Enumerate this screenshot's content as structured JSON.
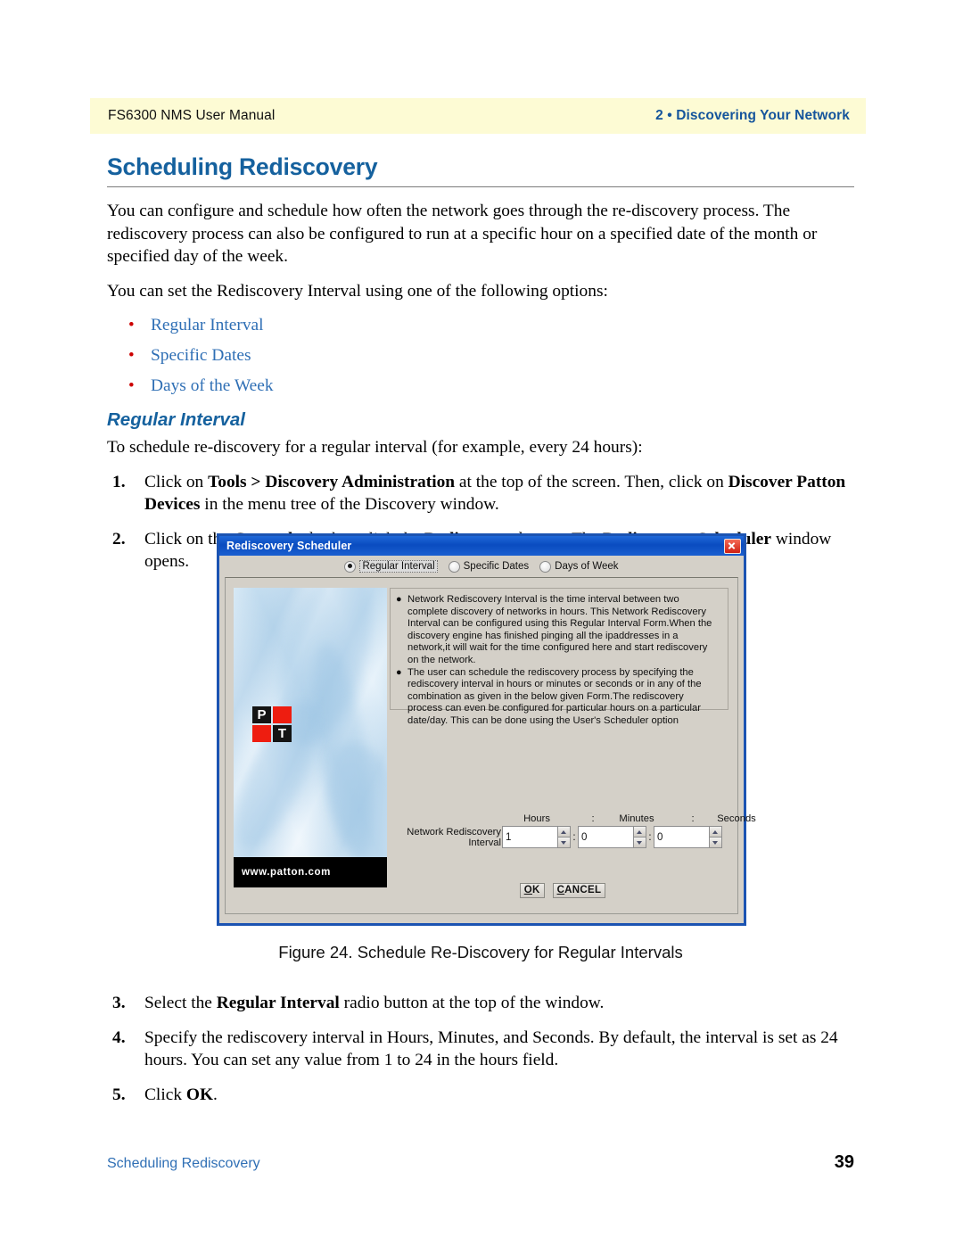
{
  "header": {
    "left": "FS6300 NMS User Manual",
    "right": "2 • Discovering Your Network"
  },
  "section": {
    "title": "Scheduling Rediscovery",
    "para1": "You can configure and schedule how often the network goes through the re-discovery process. The rediscovery process can also be configured to run at a specific hour on a specified date of the month or specified day of the week.",
    "para2": "You can set the Rediscovery Interval using one of the following options:",
    "options": [
      "Regular Interval",
      "Specific Dates",
      "Days of the Week"
    ],
    "subtitle": "Regular Interval",
    "para3": "To schedule re-discovery for a regular interval (for example, every 24 hours):"
  },
  "steps": [
    {
      "num": "1.",
      "parts": [
        {
          "t": "Click on ",
          "b": false
        },
        {
          "t": "Tools > Discovery Administration",
          "b": true
        },
        {
          "t": " at the top of the screen. Then, click on ",
          "b": false
        },
        {
          "t": "Discover Patton Devices",
          "b": true
        },
        {
          "t": " in the menu tree of the Discovery window.",
          "b": false
        }
      ]
    },
    {
      "num": "2.",
      "parts": [
        {
          "t": "Click on the ",
          "b": false
        },
        {
          "t": "General",
          "b": true
        },
        {
          "t": " tab, then click the ",
          "b": false
        },
        {
          "t": "Rediscovery",
          "b": true
        },
        {
          "t": " button. The ",
          "b": false
        },
        {
          "t": "Rediscovery Scheduler",
          "b": true
        },
        {
          "t": " window opens.",
          "b": false
        }
      ]
    },
    {
      "num": "3.",
      "parts": [
        {
          "t": "Select the ",
          "b": false
        },
        {
          "t": "Regular Interval",
          "b": true
        },
        {
          "t": " radio button at the top of the window.",
          "b": false
        }
      ]
    },
    {
      "num": "4.",
      "parts": [
        {
          "t": "Specify the rediscovery interval in Hours, Minutes, and Seconds. By default, the interval is set as 24 hours. You can set any value from 1 to 24 in the hours field.",
          "b": false
        }
      ]
    },
    {
      "num": "5.",
      "parts": [
        {
          "t": "Click ",
          "b": false
        },
        {
          "t": "OK",
          "b": true
        },
        {
          "t": ".",
          "b": false
        }
      ]
    }
  ],
  "figure": {
    "caption": "Figure 24. Schedule Re-Discovery for Regular Intervals"
  },
  "dialog": {
    "title": "Rediscovery Scheduler",
    "close_label": "×",
    "radios": [
      {
        "label": "Regular Interval",
        "selected": true,
        "focused": true
      },
      {
        "label": "Specific Dates",
        "selected": false,
        "focused": false
      },
      {
        "label": "Days of Week",
        "selected": false,
        "focused": false
      }
    ],
    "info_bullets": [
      "Network Rediscovery Interval is the time interval between two complete discovery of networks in hours. This Network Rediscovery Interval can be configured using this Regular Interval Form.When the discovery engine has finished pinging all the ipaddresses in a network,it will wait for the time configured here and start rediscovery on the network.",
      "The user can schedule the rediscovery process by specifying the rediscovery interval in hours or minutes or seconds or in any of the combination as given in the below given Form.The rediscovery process can even be configured for particular hours on a particular date/day. This can be done using the User's Scheduler option"
    ],
    "interval": {
      "field_label": "Network Rediscovery Interval",
      "hours_label": "Hours",
      "minutes_label": "Minutes",
      "seconds_label": "Seconds",
      "separator": ":",
      "hours_value": "1",
      "minutes_value": "0",
      "seconds_value": "0"
    },
    "banner": {
      "url": "www.patton.com",
      "logo_p": "P",
      "logo_t": "T"
    },
    "buttons": {
      "ok_first": "O",
      "ok_rest": "K",
      "cancel_first": "C",
      "cancel_rest": "ANCEL"
    }
  },
  "footer": {
    "left": "Scheduling Rediscovery",
    "page": "39"
  },
  "colors": {
    "heading_blue": "#15619e",
    "bullet_red": "#cc0000",
    "bullet_text_blue": "#2f6fb5",
    "header_band": "#fdfbd4",
    "titlebar_blue": "#0a4cc0",
    "dialog_face": "#d4d0c8",
    "logo_red": "#ee1d10"
  }
}
